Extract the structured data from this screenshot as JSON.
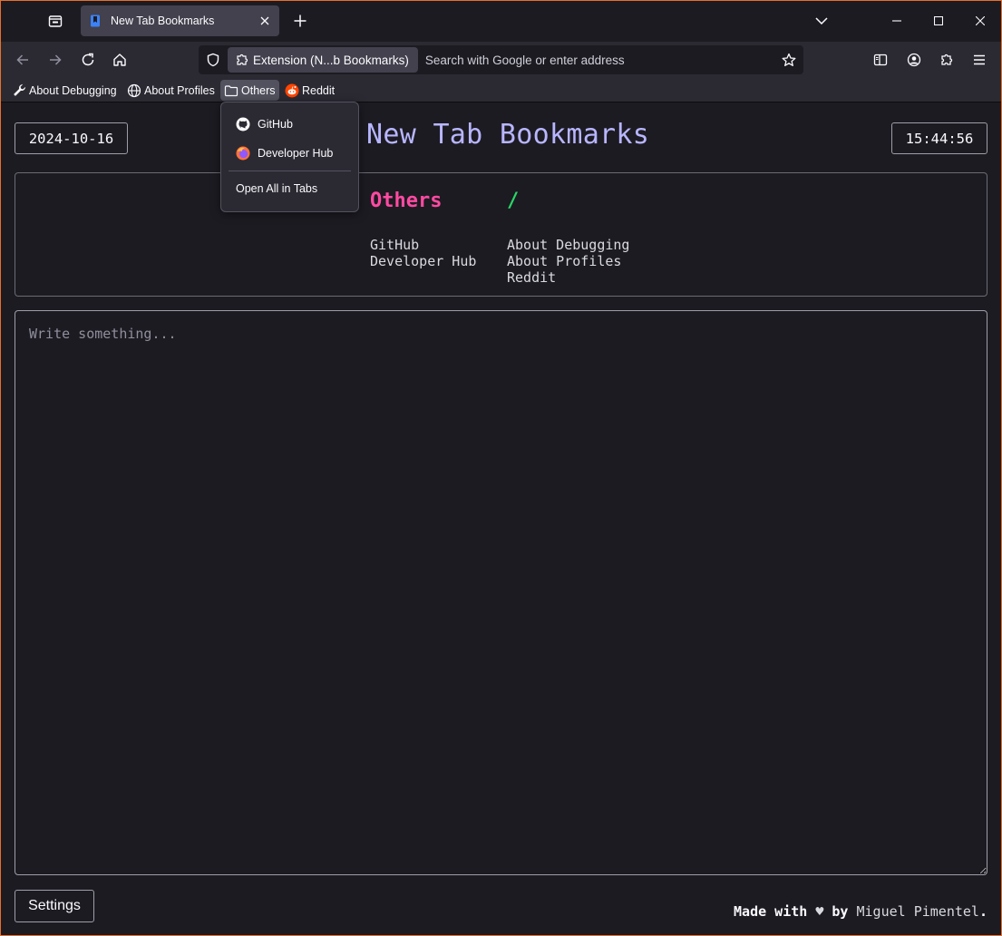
{
  "browser": {
    "tab": {
      "title": "New Tab Bookmarks",
      "close_icon": "close-icon"
    },
    "url": {
      "identity_label": "Extension (N...b Bookmarks)",
      "placeholder": "Search with Google or enter address"
    },
    "bookmarks_toolbar": [
      {
        "label": "About Debugging",
        "icon": "wrench-icon"
      },
      {
        "label": "About Profiles",
        "icon": "globe-icon"
      },
      {
        "label": "Others",
        "icon": "folder-icon"
      },
      {
        "label": "Reddit",
        "icon": "reddit-icon"
      }
    ],
    "others_menu": {
      "items": [
        {
          "label": "GitHub",
          "icon": "github-icon"
        },
        {
          "label": "Developer Hub",
          "icon": "firefox-icon"
        }
      ],
      "open_all_label": "Open All in Tabs"
    }
  },
  "page": {
    "date": "2024-10-16",
    "title": "New Tab Bookmarks",
    "time": "15:44:56",
    "columns": [
      {
        "heading": "Others",
        "color": "#ff4aa2",
        "links": [
          "GitHub",
          "Developer Hub"
        ]
      },
      {
        "heading": "/",
        "color": "#2ad766",
        "links": [
          "About Debugging",
          "About Profiles",
          "Reddit"
        ]
      }
    ],
    "notes_placeholder": "Write something...",
    "settings_label": "Settings",
    "footer": {
      "made_with": "Made with",
      "heart": "♥",
      "by": "by",
      "author": "Miguel Pimentel",
      "period": "."
    }
  },
  "colors": {
    "accent_title": "#b8b6ff",
    "frame_border": "#e8702a"
  }
}
